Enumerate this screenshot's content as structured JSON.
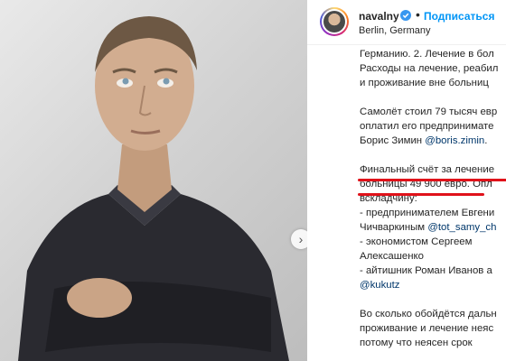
{
  "post": {
    "username": "navalny",
    "follow_label": "Подписаться",
    "separator": "•",
    "location": "Berlin, Germany",
    "verified_icon": "verified-badge-icon",
    "carousel_next_icon": "chevron-right-icon"
  },
  "caption": {
    "lines": [
      "Германию. 2. Лечение в бол",
      "Расходы на лечение, реабил",
      "и проживание вне больниц",
      "",
      "Самолёт стоил 79 тысяч евр",
      "оплатил его предпринимате",
      "Борис Зимин "
    ],
    "mention_boris": "@boris.zimin",
    "after_boris": ".",
    "final_line_1": "Финальный счёт за лечение",
    "final_line_2a": "больницы 49 900 евро",
    "final_line_2b": ". Опл",
    "paid_line": "вскладчину:",
    "donor_1a": "- предпринимателем Евгени",
    "donor_1b": "Чичваркиным ",
    "mention_tot": "@tot_samy_ch",
    "donor_2a": "- экономистом Сергеем",
    "donor_2b": "Алексашенко",
    "donor_3a": "- айтишник Роман Иванов а",
    "mention_kukutz": "@kukutz",
    "tail_1": "Во сколько обойдётся дальн",
    "tail_2": "проживание и лечение неяс",
    "tail_3": "потому что неясен срок"
  },
  "colors": {
    "accent_follow": "#0095f6",
    "mention": "#00376b",
    "highlight_underline": "#e0121a"
  }
}
